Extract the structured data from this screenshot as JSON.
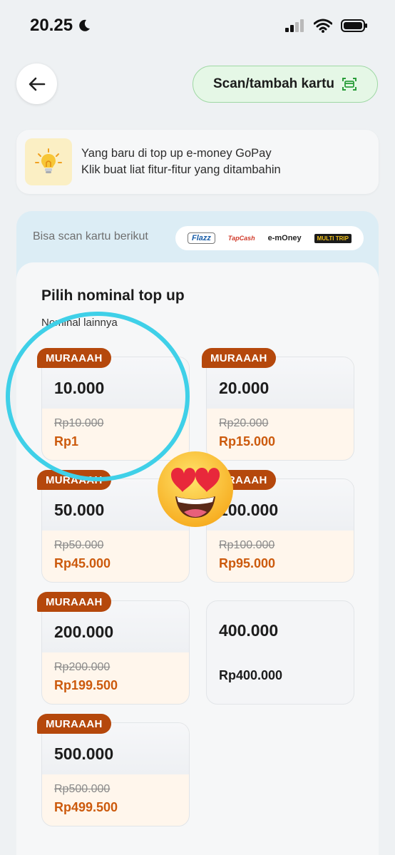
{
  "status_bar": {
    "time": "20.25"
  },
  "header": {
    "scan_label": "Scan/tambah kartu"
  },
  "info": {
    "line1": "Yang baru di top up e-money GoPay",
    "line2": "Klik buat liat fitur-fitur yang ditambahin"
  },
  "supported": {
    "label": "Bisa scan kartu berikut",
    "logos": [
      "Flazz",
      "TapCash",
      "e-mOney",
      "MULTI TRIP"
    ]
  },
  "section": {
    "title": "Pilih nominal top up",
    "other": "Nominal lainnya"
  },
  "nominals": [
    {
      "badge": "MURAAAH",
      "amount": "10.000",
      "old": "Rp10.000",
      "price": "Rp1"
    },
    {
      "badge": "MURAAAH",
      "amount": "20.000",
      "old": "Rp20.000",
      "price": "Rp15.000"
    },
    {
      "badge": "MURAAAH",
      "amount": "50.000",
      "old": "Rp50.000",
      "price": "Rp45.000"
    },
    {
      "badge": "MURAAAH",
      "amount": "100.000",
      "old": "Rp100.000",
      "price": "Rp95.000"
    },
    {
      "badge": "MURAAAH",
      "amount": "200.000",
      "old": "Rp200.000",
      "price": "Rp199.500"
    },
    {
      "badge": "",
      "amount": "400.000",
      "old": "",
      "price": "Rp400.000"
    },
    {
      "badge": "MURAAAH",
      "amount": "500.000",
      "old": "Rp500.000",
      "price": "Rp499.500"
    }
  ],
  "overlays": {
    "highlight_color": "#3fd0e8",
    "emoji": "heart-eyes-emoji"
  }
}
